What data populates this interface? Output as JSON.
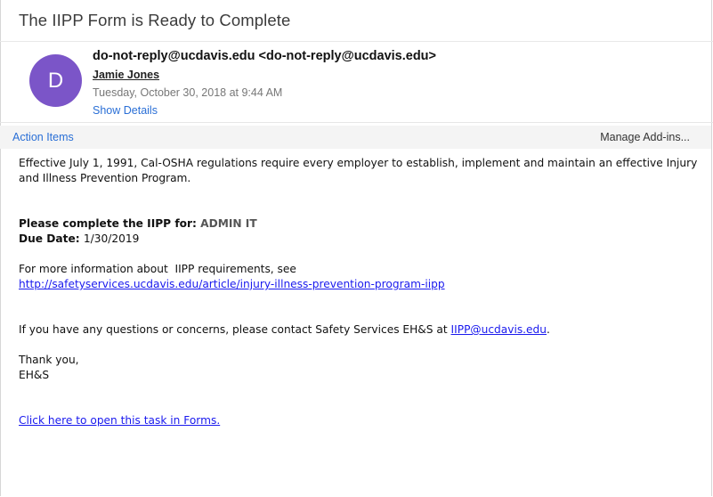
{
  "email": {
    "subject": "The IIPP Form is Ready to Complete",
    "avatar_letter": "D",
    "sender": "do-not-reply@ucdavis.edu <do-not-reply@ucdavis.edu>",
    "recipient": "Jamie Jones",
    "datetime": "Tuesday, October 30, 2018 at 9:44 AM",
    "show_details": "Show Details"
  },
  "toolbar": {
    "action_items": "Action Items",
    "manage_addins": "Manage Add-ins..."
  },
  "body": {
    "intro": "Effective July 1, 1991, Cal-OSHA regulations require every employer to establish, implement and maintain an effective Injury and Illness Prevention Program.",
    "complete_label": "Please complete the IIPP for: ",
    "complete_value": "ADMIN IT",
    "due_label": "Due Date: ",
    "due_value": "1/30/2019",
    "info_text": "For more information about  IIPP requirements, see",
    "info_link": "http://safetyservices.ucdavis.edu/article/injury-illness-prevention-program-iipp",
    "questions_text": "If you have any questions or concerns, please contact Safety Services EH&S at ",
    "questions_email": "IIPP@ucdavis.edu",
    "questions_end": ".",
    "thanks": "Thank you,",
    "signature": "EH&S",
    "open_task_link": "Click here to open this task in Forms."
  },
  "colors": {
    "avatar": "#7b55c8",
    "link_blue": "#2a6fd6",
    "body_link": "#1a1aee"
  }
}
